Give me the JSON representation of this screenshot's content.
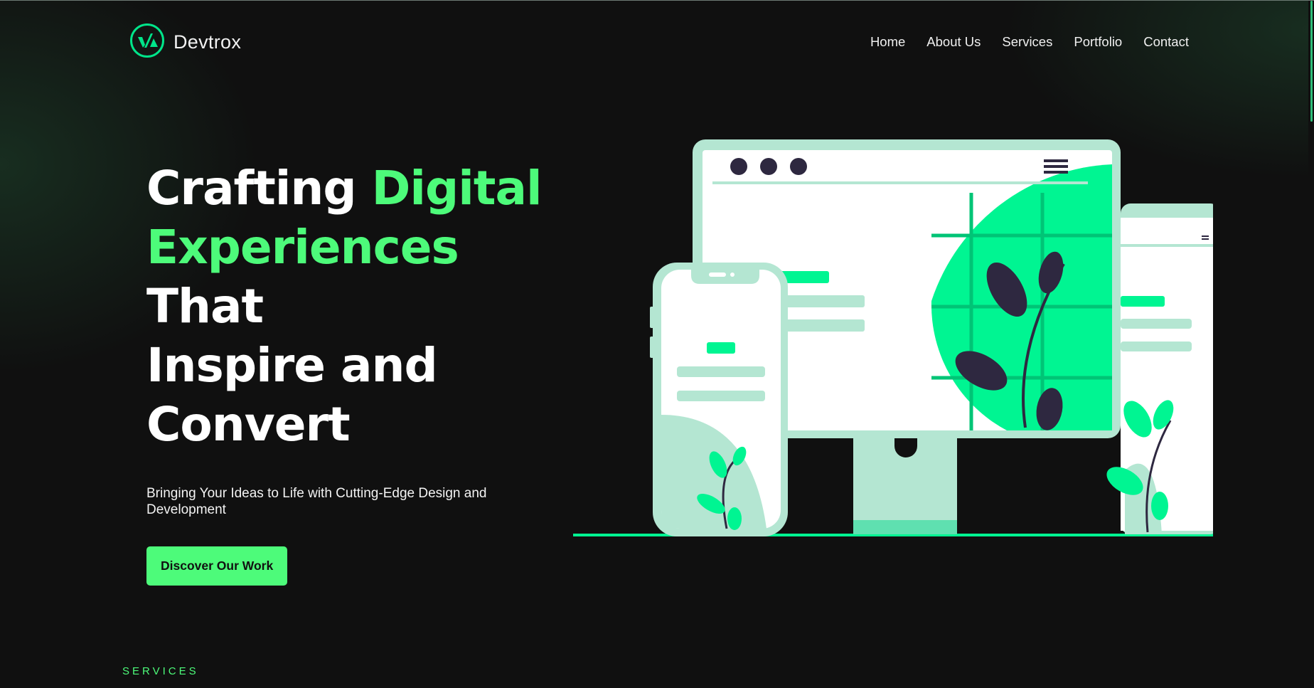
{
  "brand": {
    "name": "Devtrox",
    "logo_icon": "devtrox-logo-icon",
    "accent_color": "#4dfb7a"
  },
  "nav": {
    "items": [
      "Home",
      "About Us",
      "Services",
      "Portfolio",
      "Contact"
    ]
  },
  "hero": {
    "headline": {
      "part1": "Crafting ",
      "highlight1": "Digital",
      "highlight2": "Experiences",
      "part2": " That",
      "part3": "Inspire and",
      "part4": "Convert"
    },
    "subtitle": "Bringing Your Ideas to Life with Cutting-Edge Design and Development",
    "cta_label": "Discover Our Work",
    "illustration_icon": "responsive-devices-illustration"
  },
  "sections": {
    "services_label": "SERVICES"
  },
  "colors": {
    "background": "#101010",
    "accent": "#4dfb7a",
    "illustration_green": "#00f592",
    "illustration_mint": "#b4e6d2",
    "illustration_dark": "#2e2840"
  }
}
